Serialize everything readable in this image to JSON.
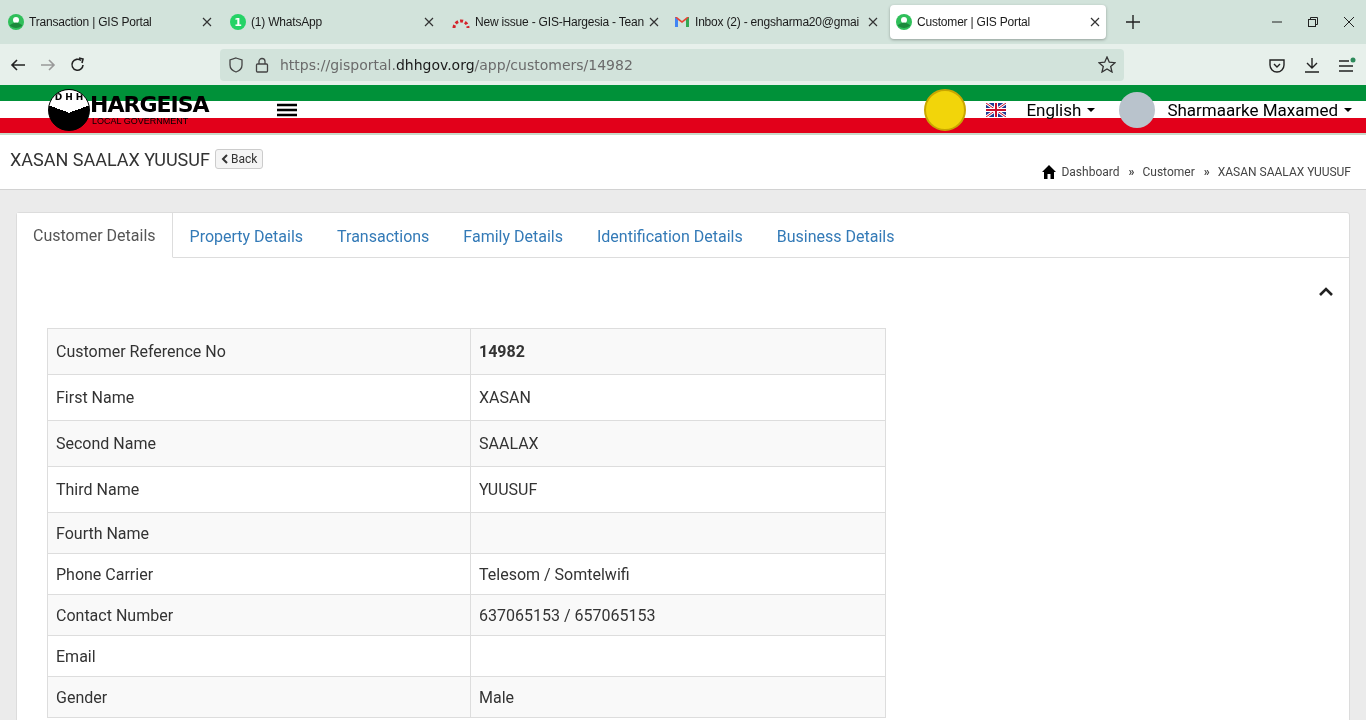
{
  "browser": {
    "tabs": [
      {
        "kind": "portal",
        "title": "Transaction | GIS Portal",
        "selected": false
      },
      {
        "kind": "chat",
        "title": "(1) WhatsApp",
        "badge": "1",
        "selected": false
      },
      {
        "kind": "issues",
        "title": "New issue - GIS-Hargesia - Tean",
        "selected": false
      },
      {
        "kind": "mail",
        "title": "Inbox (2) - engsharma20@gmai",
        "selected": false
      },
      {
        "kind": "portal",
        "title": "Customer | GIS Portal",
        "selected": true
      }
    ],
    "address": {
      "scheme": "https://gisportal.",
      "domain": "dhhgov.org",
      "path": "/app/customers/14982"
    }
  },
  "header": {
    "logo": {
      "letters": [
        "D",
        "H",
        "H"
      ],
      "title": "HARGEISA",
      "subtitle": "LOCAL GOVERNMENT"
    },
    "language": "English",
    "user": "Sharmaarke Maxamed"
  },
  "page": {
    "title": "XASAN SAALAX YUUSUF",
    "back": "Back",
    "breadcrumb": [
      {
        "label": "Dashboard"
      },
      {
        "separator": "»",
        "label": "Customer"
      },
      {
        "separator": "»",
        "label": "XASAN SAALAX YUUSUF"
      }
    ]
  },
  "tabs": [
    {
      "label": "Customer Details",
      "selected": true
    },
    {
      "label": "Property Details",
      "selected": false
    },
    {
      "label": "Transactions",
      "selected": false
    },
    {
      "label": "Family Details",
      "selected": false
    },
    {
      "label": "Identification Details",
      "selected": false
    },
    {
      "label": "Business Details",
      "selected": false
    }
  ],
  "details": [
    {
      "label": "Customer Reference No",
      "value": "14982",
      "bold": true
    },
    {
      "label": "First Name",
      "value": "XASAN",
      "bold": false
    },
    {
      "label": "Second Name",
      "value": "SAALAX",
      "bold": false
    },
    {
      "label": "Third Name",
      "value": "YUUSUF",
      "bold": false
    },
    {
      "label": "Fourth Name"
    },
    {
      "label": "Phone Carrier",
      "value": "Telesom / Somtelwifi",
      "bold": false
    },
    {
      "label": "Contact Number",
      "value": "637065153 / 657065153",
      "bold": false
    },
    {
      "label": "Email"
    },
    {
      "label": "Gender",
      "value": "Male",
      "bold": false
    }
  ]
}
